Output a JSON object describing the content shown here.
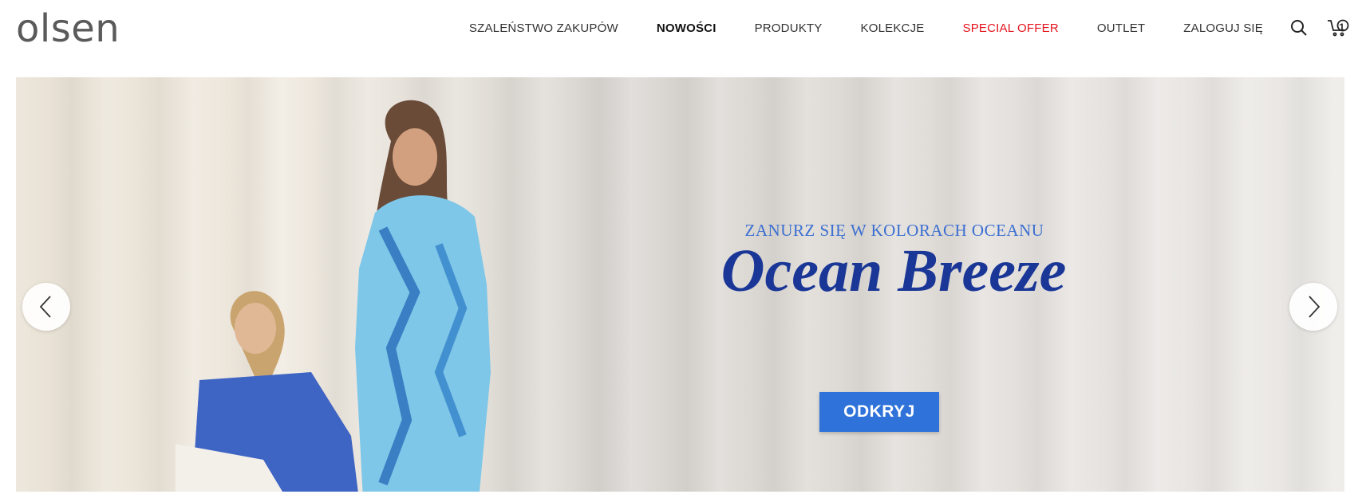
{
  "brand": {
    "logo_text": "olsen"
  },
  "nav": {
    "items": [
      {
        "label": "SZALEŃSTWO ZAKUPÓW"
      },
      {
        "label": "NOWOŚCI"
      },
      {
        "label": "PRODUKTY"
      },
      {
        "label": "KOLEKCJE"
      },
      {
        "label": "SPECIAL OFFER"
      },
      {
        "label": "OUTLET"
      },
      {
        "label": "ZALOGUJ SIĘ"
      }
    ],
    "cart_count": "1",
    "icons": [
      "search-icon",
      "cart-icon"
    ]
  },
  "hero": {
    "subtitle": "ZANURZ SIĘ W KOLORACH OCEANU",
    "title": "Ocean Breeze",
    "cta_label": "ODKRYJ",
    "prev_icon": "chevron-left-icon",
    "next_icon": "chevron-right-icon"
  },
  "colors": {
    "accent_blue": "#2f72d9",
    "title_blue": "#1a3797",
    "subtitle_blue": "#3b6fd1",
    "special_offer_red": "#e4151f"
  }
}
